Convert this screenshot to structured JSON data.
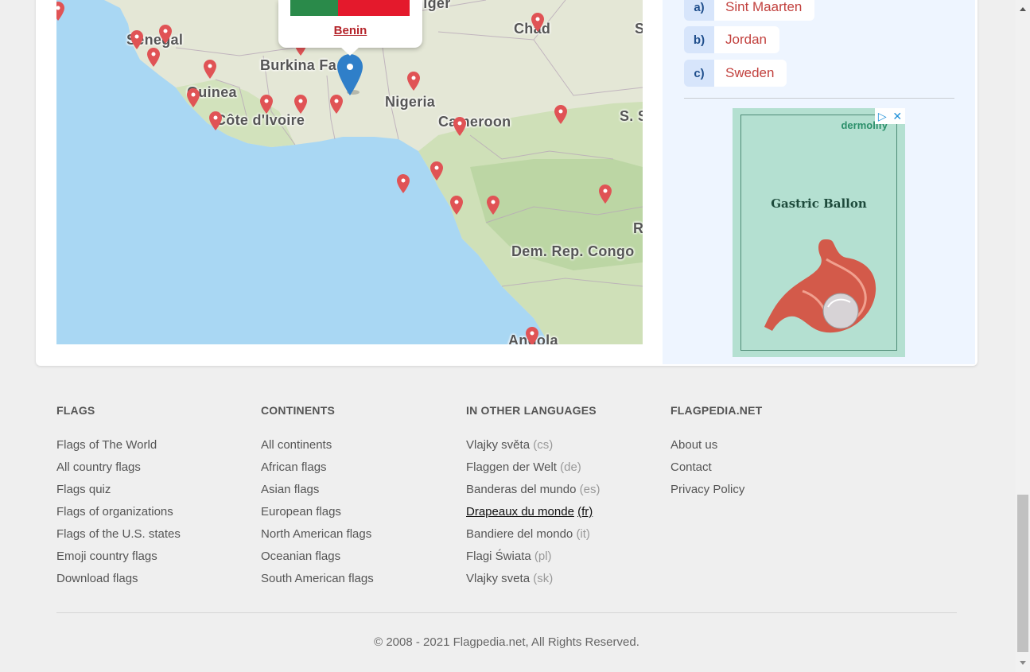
{
  "map": {
    "labels": {
      "senegal": "Senegal",
      "burkina": "Burkina Fa",
      "niger": "Niger",
      "chad": "Chad",
      "guinea": "Guinea",
      "ivoire": "Côte d'Ivoire",
      "nigeria": "Nigeria",
      "cameroon": "Cameroon",
      "s_sudan": "S. S",
      "drc": "Dem. Rep. Congo",
      "angola": "Angola",
      "edge_s": "S",
      "edge_r": "R"
    },
    "popup": {
      "country": "Benin",
      "flag_colors": [
        "#2a8a4a",
        "#e4192c"
      ]
    },
    "marker_color": "#e05355",
    "active_marker_color": "#2f7fc9"
  },
  "quiz": {
    "answers": [
      {
        "key": "a)",
        "value": "Sint Maarten"
      },
      {
        "key": "b)",
        "value": "Jordan"
      },
      {
        "key": "c)",
        "value": "Sweden"
      }
    ]
  },
  "ad": {
    "brand": "dermolify",
    "headline": "Gastric Ballon",
    "choices_icon": "adchoices-icon",
    "close_icon": "close-icon"
  },
  "footer": {
    "columns": [
      {
        "title": "FLAGS",
        "items": [
          {
            "text": "Flags of The World"
          },
          {
            "text": "All country flags"
          },
          {
            "text": "Flags quiz"
          },
          {
            "text": "Flags of organizations"
          },
          {
            "text": "Flags of the U.S. states"
          },
          {
            "text": "Emoji country flags"
          },
          {
            "text": "Download flags"
          }
        ]
      },
      {
        "title": "CONTINENTS",
        "items": [
          {
            "text": "All continents"
          },
          {
            "text": "African flags"
          },
          {
            "text": "Asian flags"
          },
          {
            "text": "European flags"
          },
          {
            "text": "North American flags"
          },
          {
            "text": "Oceanian flags"
          },
          {
            "text": "South American flags"
          }
        ]
      },
      {
        "title": "IN OTHER LANGUAGES",
        "items": [
          {
            "text": "Vlajky světa",
            "lang": "(cs)"
          },
          {
            "text": "Flaggen der Welt",
            "lang": "(de)"
          },
          {
            "text": "Banderas del mundo",
            "lang": "(es)"
          },
          {
            "text": "Drapeaux du monde",
            "lang": "(fr)"
          },
          {
            "text": "Bandiere del mondo",
            "lang": "(it)"
          },
          {
            "text": "Flagi Świata",
            "lang": "(pl)"
          },
          {
            "text": "Vlajky sveta",
            "lang": "(sk)"
          }
        ]
      },
      {
        "title": "FLAGPEDIA.NET",
        "items": [
          {
            "text": "About us"
          },
          {
            "text": "Contact"
          },
          {
            "text": "Privacy Policy"
          }
        ]
      }
    ],
    "copyright": "© 2008 - 2021 Flagpedia.net, All Rights Reserved."
  }
}
